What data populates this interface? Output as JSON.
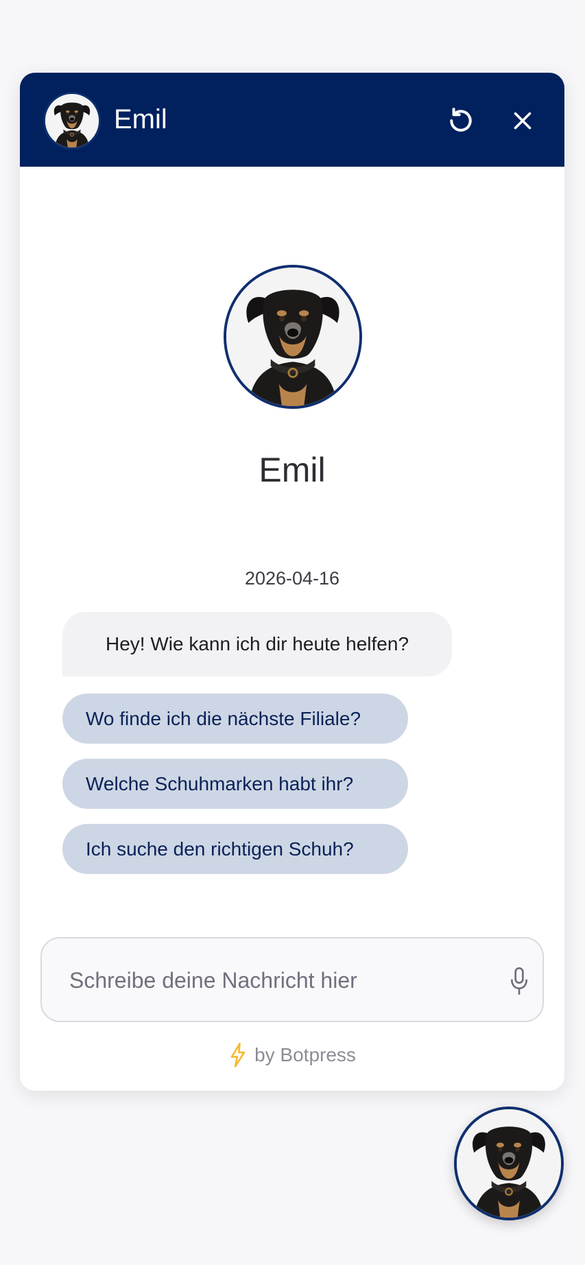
{
  "header": {
    "title": "Emil",
    "restart_icon": "restart-icon",
    "close_icon": "close-icon"
  },
  "bot": {
    "name": "Emil",
    "avatar_icon": "dog-avatar"
  },
  "conversation": {
    "date": "2026-04-16",
    "bot_message": "Hey! Wie kann ich dir heute helfen?",
    "quick_replies": [
      "Wo finde ich die nächste Filiale?",
      "Welche Schuhmarken habt ihr?",
      "Ich suche den richtigen Schuh?"
    ]
  },
  "composer": {
    "placeholder": "Schreibe deine Nachricht hier",
    "mic_icon": "microphone-icon"
  },
  "branding": {
    "text": "by Botpress",
    "icon": "lightning-icon"
  },
  "colors": {
    "header_bg": "#00215e",
    "quick_reply_bg": "#cdd6e4",
    "quick_reply_text": "#0a2157",
    "bot_bubble_bg": "#f2f2f5",
    "lightning": "#f5b82e"
  }
}
